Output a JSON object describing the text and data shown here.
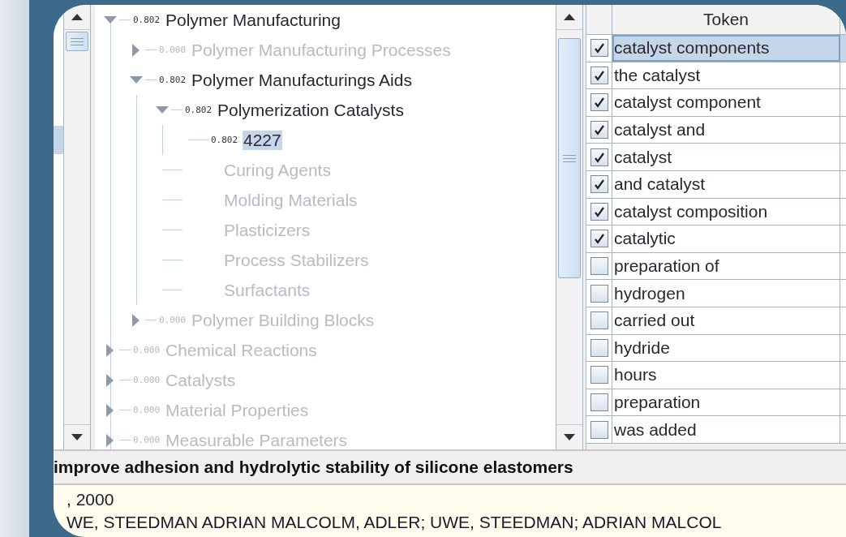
{
  "tree": [
    {
      "score": "0.802",
      "label": "Polymer Manufacturing",
      "active": true,
      "expanded": true,
      "selected": false,
      "children": [
        {
          "score": "0.000",
          "label": "Polymer Manufacturing Processes",
          "active": false,
          "expanded": false,
          "selected": false
        },
        {
          "score": "0.802",
          "label": "Polymer Manufacturings Aids",
          "active": true,
          "expanded": true,
          "selected": false,
          "children": [
            {
              "score": "0.802",
              "label": "Polymerization Catalysts",
              "active": true,
              "expanded": true,
              "selected": false,
              "children": [
                {
                  "score": "0.802",
                  "label": "4227",
                  "kind": "leaf",
                  "active": true,
                  "selected": true
                }
              ]
            },
            {
              "label": "Curing Agents",
              "kind": "leaf",
              "active": false,
              "selected": false
            },
            {
              "label": "Molding Materials",
              "kind": "leaf",
              "active": false,
              "selected": false
            },
            {
              "label": "Plasticizers",
              "kind": "leaf",
              "active": false,
              "selected": false
            },
            {
              "label": "Process Stabilizers",
              "kind": "leaf",
              "active": false,
              "selected": false
            },
            {
              "label": "Surfactants",
              "kind": "leaf",
              "active": false,
              "selected": false
            }
          ]
        },
        {
          "score": "0.000",
          "label": "Polymer Building Blocks",
          "active": false,
          "expanded": false,
          "selected": false
        }
      ]
    },
    {
      "score": "0.000",
      "label": "Chemical Reactions",
      "active": false,
      "expanded": false,
      "selected": false
    },
    {
      "score": "0.000",
      "label": "Catalysts",
      "active": false,
      "expanded": false,
      "selected": false
    },
    {
      "score": "0.000",
      "label": "Material Properties",
      "active": false,
      "expanded": false,
      "selected": false
    },
    {
      "score": "0.000",
      "label": "Measurable Parameters",
      "active": false,
      "expanded": false,
      "selected": false
    }
  ],
  "table": {
    "columns": [
      "Token"
    ],
    "rows": [
      {
        "checked": true,
        "token": "catalyst components",
        "selected": true
      },
      {
        "checked": true,
        "token": "the catalyst",
        "selected": false
      },
      {
        "checked": true,
        "token": "catalyst component",
        "selected": false
      },
      {
        "checked": true,
        "token": "catalyst and",
        "selected": false
      },
      {
        "checked": true,
        "token": "catalyst",
        "selected": false
      },
      {
        "checked": true,
        "token": "and catalyst",
        "selected": false
      },
      {
        "checked": true,
        "token": "catalyst composition",
        "selected": false
      },
      {
        "checked": true,
        "token": "catalytic",
        "selected": false
      },
      {
        "checked": false,
        "token": "preparation of",
        "selected": false
      },
      {
        "checked": false,
        "token": "hydrogen",
        "selected": false
      },
      {
        "checked": false,
        "token": "carried out",
        "selected": false
      },
      {
        "checked": false,
        "token": "hydride",
        "selected": false
      },
      {
        "checked": false,
        "token": "hours",
        "selected": false
      },
      {
        "checked": false,
        "token": "preparation",
        "selected": false
      },
      {
        "checked": false,
        "token": "was added",
        "selected": false
      }
    ]
  },
  "document": {
    "title": "improve adhesion and hydrolytic stability of silicone elastomers",
    "date": ", 2000",
    "authors": "WE, STEEDMAN ADRIAN MALCOLM, ADLER; UWE, STEEDMAN; ADRIAN MALCOL"
  }
}
